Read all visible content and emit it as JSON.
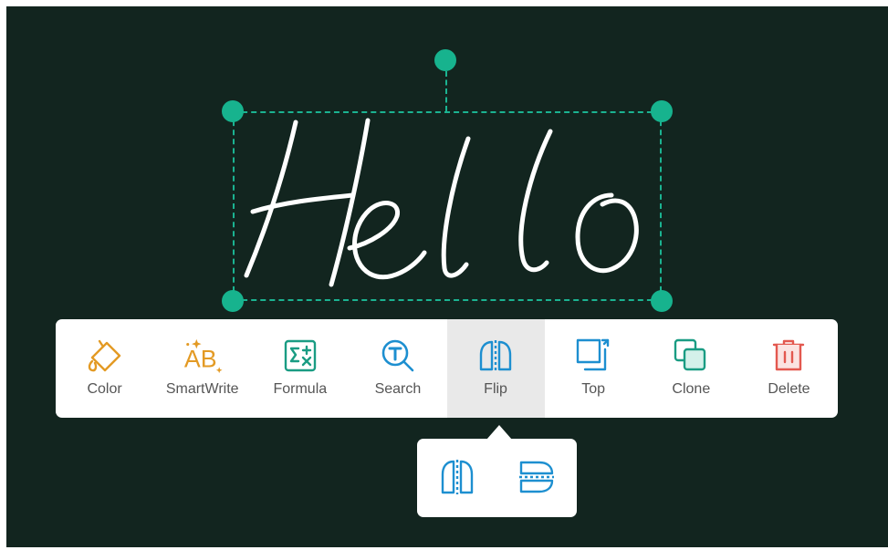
{
  "canvas": {
    "handwritten_text": "Hello"
  },
  "toolbar": {
    "items": [
      {
        "label": "Color",
        "icon": "paint-bucket-icon"
      },
      {
        "label": "SmartWrite",
        "icon": "smartwrite-ab-icon"
      },
      {
        "label": "Formula",
        "icon": "formula-icon"
      },
      {
        "label": "Search",
        "icon": "search-icon"
      },
      {
        "label": "Flip",
        "icon": "flip-icon",
        "active": true
      },
      {
        "label": "Top",
        "icon": "bring-to-top-icon"
      },
      {
        "label": "Clone",
        "icon": "clone-icon"
      },
      {
        "label": "Delete",
        "icon": "trash-icon"
      }
    ]
  },
  "flip_submenu": {
    "options": [
      {
        "icon": "flip-horizontal-icon"
      },
      {
        "icon": "flip-vertical-icon"
      }
    ]
  },
  "colors": {
    "board": "#12251f",
    "selection": "#1bb391",
    "orange": "#e39a24",
    "teal": "#1a9c83",
    "blue": "#1d8fd0",
    "red": "#e3584f"
  }
}
